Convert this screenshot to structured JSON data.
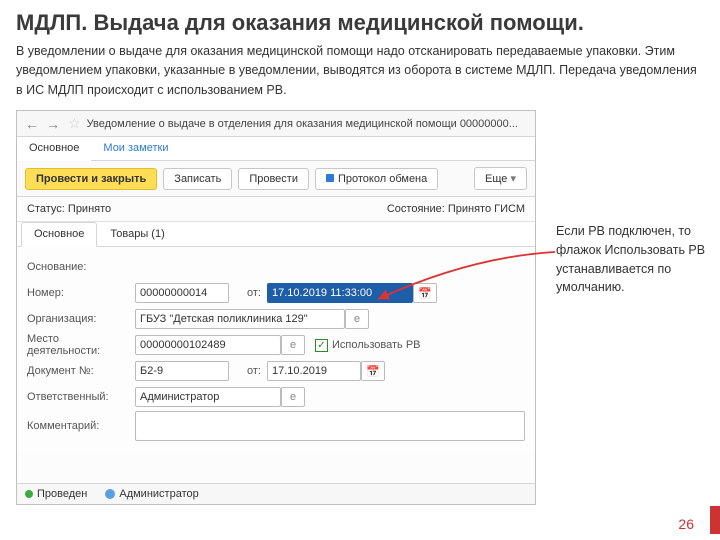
{
  "slide": {
    "title": "МДЛП. Выдача для оказания медицинской помощи.",
    "desc": "В уведомлении о выдаче  для оказания медицинской помощи надо отсканировать передаваемые упаковки. Этим уведомлением упаковки, указанные в уведомлении, выводятся из оборота в системе МДЛП. Передача уведомления в ИС МДЛП происходит с использованием РВ.",
    "side_note": "Если РВ подключен, то флажок Использовать РВ устанавливается по умолчанию.",
    "page": "26"
  },
  "window": {
    "title": "Уведомление о выдаче в отделения для оказания медицинской помощи 00000000...",
    "tabs": {
      "main": "Основное",
      "notes": "Мои заметки"
    },
    "toolbar": {
      "post_close": "Провести и закрыть",
      "save": "Записать",
      "post": "Провести",
      "protocol": "Протокол обмена",
      "more": "Еще"
    },
    "status": {
      "label": "Статус:",
      "value": "Принято",
      "state_label": "Состояние:",
      "state_value": "Принято ГИСМ"
    },
    "subtabs": {
      "main": "Основное",
      "goods": "Товары (1)"
    },
    "fields": {
      "basis_lbl": "Основание:",
      "number_lbl": "Номер:",
      "number_val": "00000000014",
      "from_lbl": "от:",
      "date_val": "17.10.2019 11:33:00",
      "org_lbl": "Организация:",
      "org_val": "ГБУЗ \"Детская поликлиника 129\"",
      "place_lbl": "Место деятельности:",
      "place_val": "00000000102489",
      "use_rv_lbl": "Использовать РВ",
      "doc_lbl": "Документ №:",
      "doc_val": "Б2-9",
      "doc_from_lbl": "от:",
      "doc_date_val": "17.10.2019",
      "resp_lbl": "Ответственный:",
      "resp_val": "Администратор",
      "comment_lbl": "Комментарий:"
    },
    "footer": {
      "posted": "Проведен",
      "admin": "Администратор"
    },
    "icons": {
      "cal": "📅",
      "open": "▾",
      "e": "e",
      "check": "✓"
    }
  }
}
